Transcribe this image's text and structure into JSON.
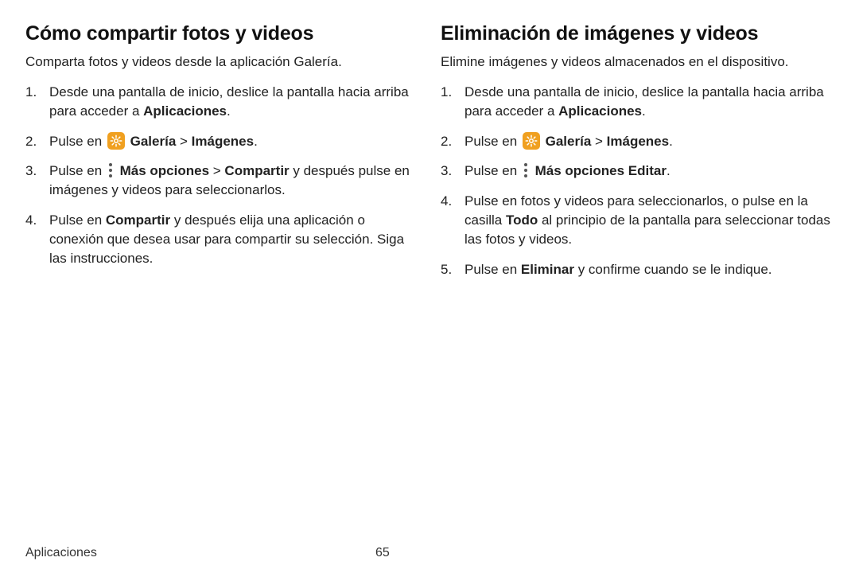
{
  "left": {
    "title": "Cómo compartir fotos y videos",
    "intro": "Comparta fotos y videos desde la aplicación Galería.",
    "steps": [
      {
        "num": "1.",
        "parts": [
          {
            "t": "text",
            "v": "Desde una pantalla de inicio, deslice la pantalla hacia arriba para acceder a "
          },
          {
            "t": "bold",
            "v": "Aplicaciones"
          },
          {
            "t": "text",
            "v": "."
          }
        ]
      },
      {
        "num": "2.",
        "parts": [
          {
            "t": "text",
            "v": "Pulse en "
          },
          {
            "t": "icon",
            "v": "gallery-icon"
          },
          {
            "t": "text",
            "v": " "
          },
          {
            "t": "bold",
            "v": "Galería"
          },
          {
            "t": "text",
            "v": " > "
          },
          {
            "t": "bold",
            "v": "Imágenes"
          },
          {
            "t": "text",
            "v": "."
          }
        ]
      },
      {
        "num": "3.",
        "parts": [
          {
            "t": "text",
            "v": "Pulse en "
          },
          {
            "t": "icon",
            "v": "more-icon"
          },
          {
            "t": "text",
            "v": " "
          },
          {
            "t": "bold",
            "v": "Más opciones"
          },
          {
            "t": "text",
            "v": " > "
          },
          {
            "t": "bold",
            "v": "Compartir"
          },
          {
            "t": "text",
            "v": " y después pulse en imágenes y videos para seleccionarlos."
          }
        ]
      },
      {
        "num": "4.",
        "parts": [
          {
            "t": "text",
            "v": "Pulse en "
          },
          {
            "t": "bold",
            "v": "Compartir"
          },
          {
            "t": "text",
            "v": " y después elija una aplicación o conexión que desea usar para compartir su selección. Siga las instrucciones."
          }
        ]
      }
    ]
  },
  "right": {
    "title": "Eliminación de imágenes y videos",
    "intro": "Elimine imágenes y videos almacenados en el dispositivo.",
    "steps": [
      {
        "num": "1.",
        "parts": [
          {
            "t": "text",
            "v": "Desde una pantalla de inicio, deslice la pantalla hacia arriba para acceder a "
          },
          {
            "t": "bold",
            "v": "Aplicaciones"
          },
          {
            "t": "text",
            "v": "."
          }
        ]
      },
      {
        "num": "2.",
        "parts": [
          {
            "t": "text",
            "v": "Pulse en "
          },
          {
            "t": "icon",
            "v": "gallery-icon"
          },
          {
            "t": "text",
            "v": " "
          },
          {
            "t": "bold",
            "v": "Galería"
          },
          {
            "t": "text",
            "v": " > "
          },
          {
            "t": "bold",
            "v": "Imágenes"
          },
          {
            "t": "text",
            "v": "."
          }
        ]
      },
      {
        "num": "3.",
        "parts": [
          {
            "t": "text",
            "v": "Pulse en "
          },
          {
            "t": "icon",
            "v": "more-icon"
          },
          {
            "t": "text",
            "v": " "
          },
          {
            "t": "bold",
            "v": "Más opciones"
          },
          {
            "t": "text",
            "v": " "
          },
          {
            "t": "bold",
            "v": "Editar"
          },
          {
            "t": "text",
            "v": "."
          }
        ]
      },
      {
        "num": "4.",
        "parts": [
          {
            "t": "text",
            "v": "Pulse en fotos y videos para seleccionarlos, o pulse en la casilla "
          },
          {
            "t": "bold",
            "v": "Todo"
          },
          {
            "t": "text",
            "v": " al principio de la pantalla para seleccionar todas las fotos y videos."
          }
        ]
      },
      {
        "num": "5.",
        "parts": [
          {
            "t": "text",
            "v": "Pulse en "
          },
          {
            "t": "bold",
            "v": "Eliminar"
          },
          {
            "t": "text",
            "v": " y confirme cuando se le indique."
          }
        ]
      }
    ]
  },
  "footer": {
    "section": "Aplicaciones",
    "page": "65"
  }
}
